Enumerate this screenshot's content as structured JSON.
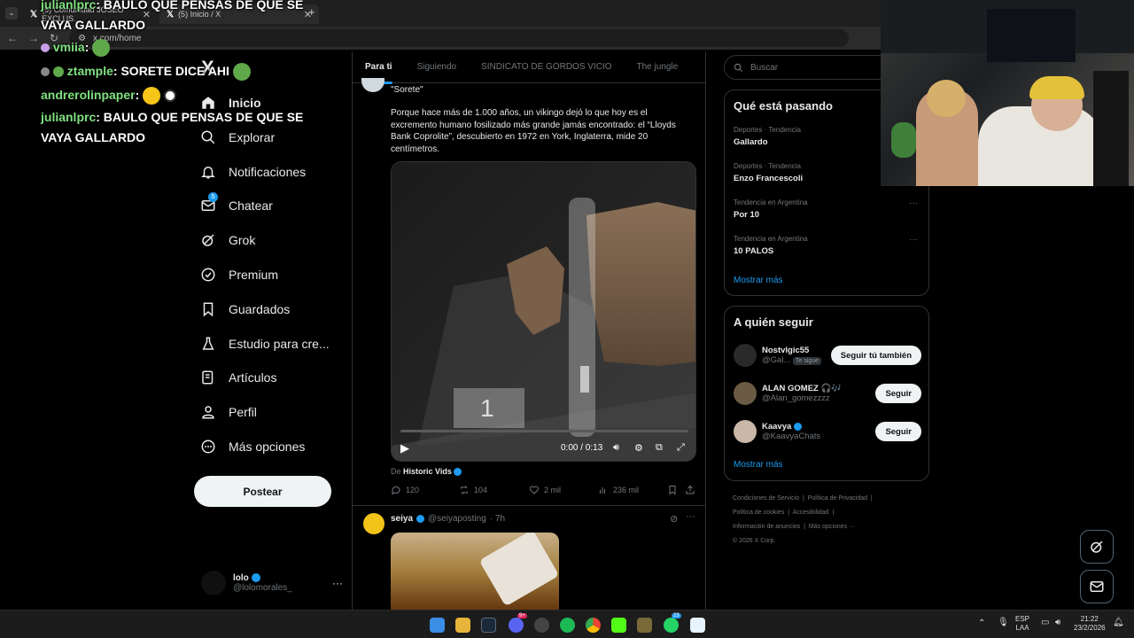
{
  "browser": {
    "tabs": [
      {
        "title": "(5) Comunidad JOSEO EXCLUS…"
      },
      {
        "title": "(5) Inicio / X"
      }
    ],
    "new_tab": "+",
    "url": "x.com/home"
  },
  "chat": [
    {
      "user": "julianlprc",
      "message": "BAULO QUE PENSAS DE QUE SE VAYA GALLARDO"
    },
    {
      "user": "vmiia",
      "message": ""
    },
    {
      "user": "ztample",
      "message": "SORETE DICE AHI"
    },
    {
      "user": "andrerolinpaper",
      "message": ""
    },
    {
      "user": "julianlprc",
      "message": "BAULO QUE PENSAS DE QUE SE VAYA GALLARDO"
    }
  ],
  "logo": "X",
  "nav": [
    {
      "label": "Inicio",
      "icon": "home-icon"
    },
    {
      "label": "Explorar",
      "icon": "search-icon"
    },
    {
      "label": "Notificaciones",
      "icon": "bell-icon"
    },
    {
      "label": "Chatear",
      "icon": "chat-icon"
    },
    {
      "label": "Grok",
      "icon": "grok-icon"
    },
    {
      "label": "Premium",
      "icon": "premium-icon"
    },
    {
      "label": "Guardados",
      "icon": "bookmark-icon"
    },
    {
      "label": "Estudio para cre...",
      "icon": "studio-icon"
    },
    {
      "label": "Artículos",
      "icon": "article-icon"
    },
    {
      "label": "Perfil",
      "icon": "person-icon"
    },
    {
      "label": "Más opciones",
      "icon": "more-icon"
    }
  ],
  "nav_badge": "5",
  "post_button": "Postear",
  "account": {
    "name": "lolo",
    "handle": "@lolomorales_",
    "menu": "···"
  },
  "main_tabs": [
    "Para ti",
    "Siguiendo",
    "SINDICATO DE GORDOS VICIO",
    "The jungle"
  ],
  "tweet1": {
    "quote": "\"Sorete\"",
    "text": "Porque hace más de 1.000 años, un vikingo dejó lo que hoy es el excremento humano fosilizado más grande jamás encontrado: el “Lloyds Bank Coprolite”, descubierto en 1972 en York, Inglaterra, mide 20 centímetros.",
    "video_time": "0:00 / 0:13",
    "video_progress": 0,
    "video_label": "1",
    "source_prefix": "De",
    "source": "Historic Vids",
    "replies": "120",
    "reposts": "104",
    "likes": "2 mil",
    "views": "236 mil"
  },
  "tweet2": {
    "name": "seiya",
    "handle": "@seiyaposting",
    "time": "· 7h"
  },
  "search_placeholder": "Buscar",
  "trends": {
    "title": "Qué está pasando",
    "items": [
      {
        "category": "Deportes · Tendencia",
        "name": "Gallardo"
      },
      {
        "category": "Deportes · Tendencia",
        "name": "Enzo Francescoli"
      },
      {
        "category": "Tendencia en Argentina",
        "name": "Por 10"
      },
      {
        "category": "Tendencia en Argentina",
        "name": "10 PALOS"
      }
    ],
    "more": "Mostrar más"
  },
  "who_to_follow": {
    "title": "A quién seguir",
    "items": [
      {
        "name": "Nostvlgic55",
        "handle": "@Gal...",
        "badge": "Te sigue",
        "button": "Seguir tú también",
        "avatar_color": "#2a2a2a"
      },
      {
        "name": "ALAN GOMEZ 🎧🎶",
        "handle": "@Alan_gomezzzz",
        "badge": "",
        "button": "Seguir",
        "avatar_color": "#6b5a44"
      },
      {
        "name": "Kaavya",
        "handle": "@KaavyaChats",
        "badge": "",
        "button": "Seguir",
        "avatar_color": "#c9b7a8"
      }
    ],
    "more": "Mostrar más"
  },
  "footer": {
    "line1a": "Condiciones de Servicio",
    "line1b": "Política de Privacidad",
    "line2a": "Política de cookies",
    "line2b": "Accesibilidad",
    "line3a": "Información de anuncios",
    "line3b": "Más opciones ···",
    "copyright": "© 2026 X Corp."
  },
  "taskbar": {
    "lang1": "ESP",
    "lang2": "LAA",
    "time": "21:22",
    "date": "23/2/2026",
    "badges": {
      "discord": "9+",
      "whatsapp": "23"
    }
  },
  "colors": {
    "accent": "#1d9bf0",
    "verified": "#1d9bf0",
    "chat_user": "#7fe07f"
  }
}
